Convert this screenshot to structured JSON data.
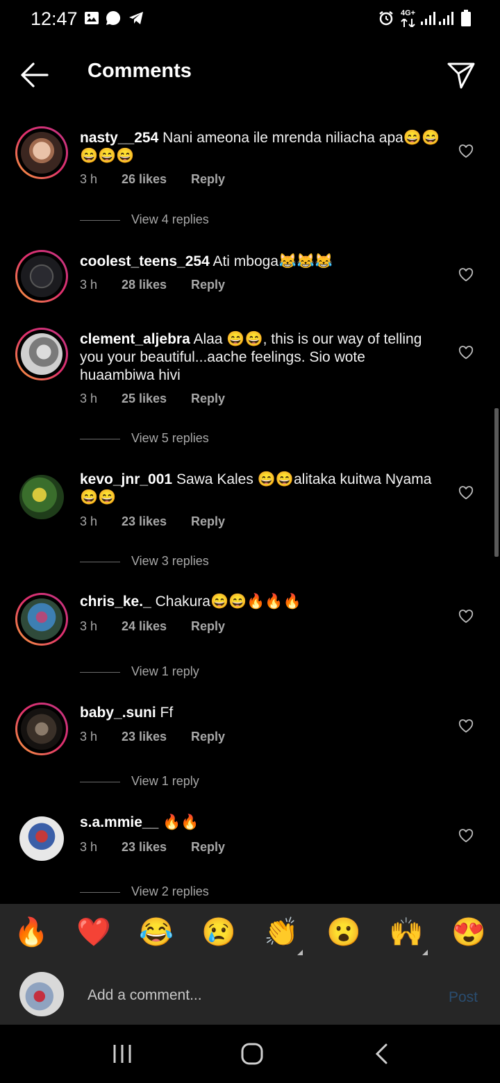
{
  "status_bar": {
    "time": "12:47",
    "network": "4G+",
    "icons": [
      "image-icon",
      "message-icon",
      "telegram-icon",
      "alarm-icon",
      "signal-icon",
      "battery-icon"
    ]
  },
  "header": {
    "title": "Comments",
    "back_icon": "arrow-left-icon",
    "share_icon": "send-icon"
  },
  "comments": [
    {
      "username": "nasty__254",
      "text": "Nani ameona ile mrenda niliacha apa😄😄😄😄😄",
      "time": "3 h",
      "likes": "26 likes",
      "reply": "Reply",
      "view_replies": "View 4 replies"
    },
    {
      "username": "coolest_teens_254",
      "text": "Ati mboga😹😹😹",
      "time": "3 h",
      "likes": "28 likes",
      "reply": "Reply"
    },
    {
      "username": "clement_aljebra",
      "text": "Alaa 😄😄, this is our way of telling you your beautiful...aache feelings. Sio wote huaambiwa hivi",
      "time": "3 h",
      "likes": "25 likes",
      "reply": "Reply",
      "view_replies": "View 5 replies"
    },
    {
      "username": "kevo_jnr_001",
      "text": "Sawa Kales 😄😄alitaka kuitwa Nyama 😄😄",
      "time": "3 h",
      "likes": "23 likes",
      "reply": "Reply",
      "view_replies": "View 3 replies"
    },
    {
      "username": "chris_ke._",
      "text": "Chakura😄😄🔥🔥🔥",
      "time": "3 h",
      "likes": "24 likes",
      "reply": "Reply",
      "view_replies": "View 1 reply"
    },
    {
      "username": "baby_.suni",
      "text": "Ff",
      "time": "3 h",
      "likes": "23 likes",
      "reply": "Reply",
      "view_replies": "View 1 reply"
    },
    {
      "username": "s.a.mmie__",
      "text": "🔥🔥",
      "time": "3 h",
      "likes": "23 likes",
      "reply": "Reply",
      "view_replies": "View 2 replies"
    }
  ],
  "emoji_bar": [
    "🔥",
    "❤️",
    "😂",
    "😢",
    "👏",
    "😮",
    "🙌",
    "😍"
  ],
  "composer": {
    "placeholder": "Add a comment...",
    "post_label": "Post"
  },
  "colors": {
    "background": "#000000",
    "panel": "#262626",
    "muted_text": "#a8a8a8",
    "post_disabled": "#2a4d70",
    "ring_start": "#f9a23b",
    "ring_end": "#c13584"
  }
}
